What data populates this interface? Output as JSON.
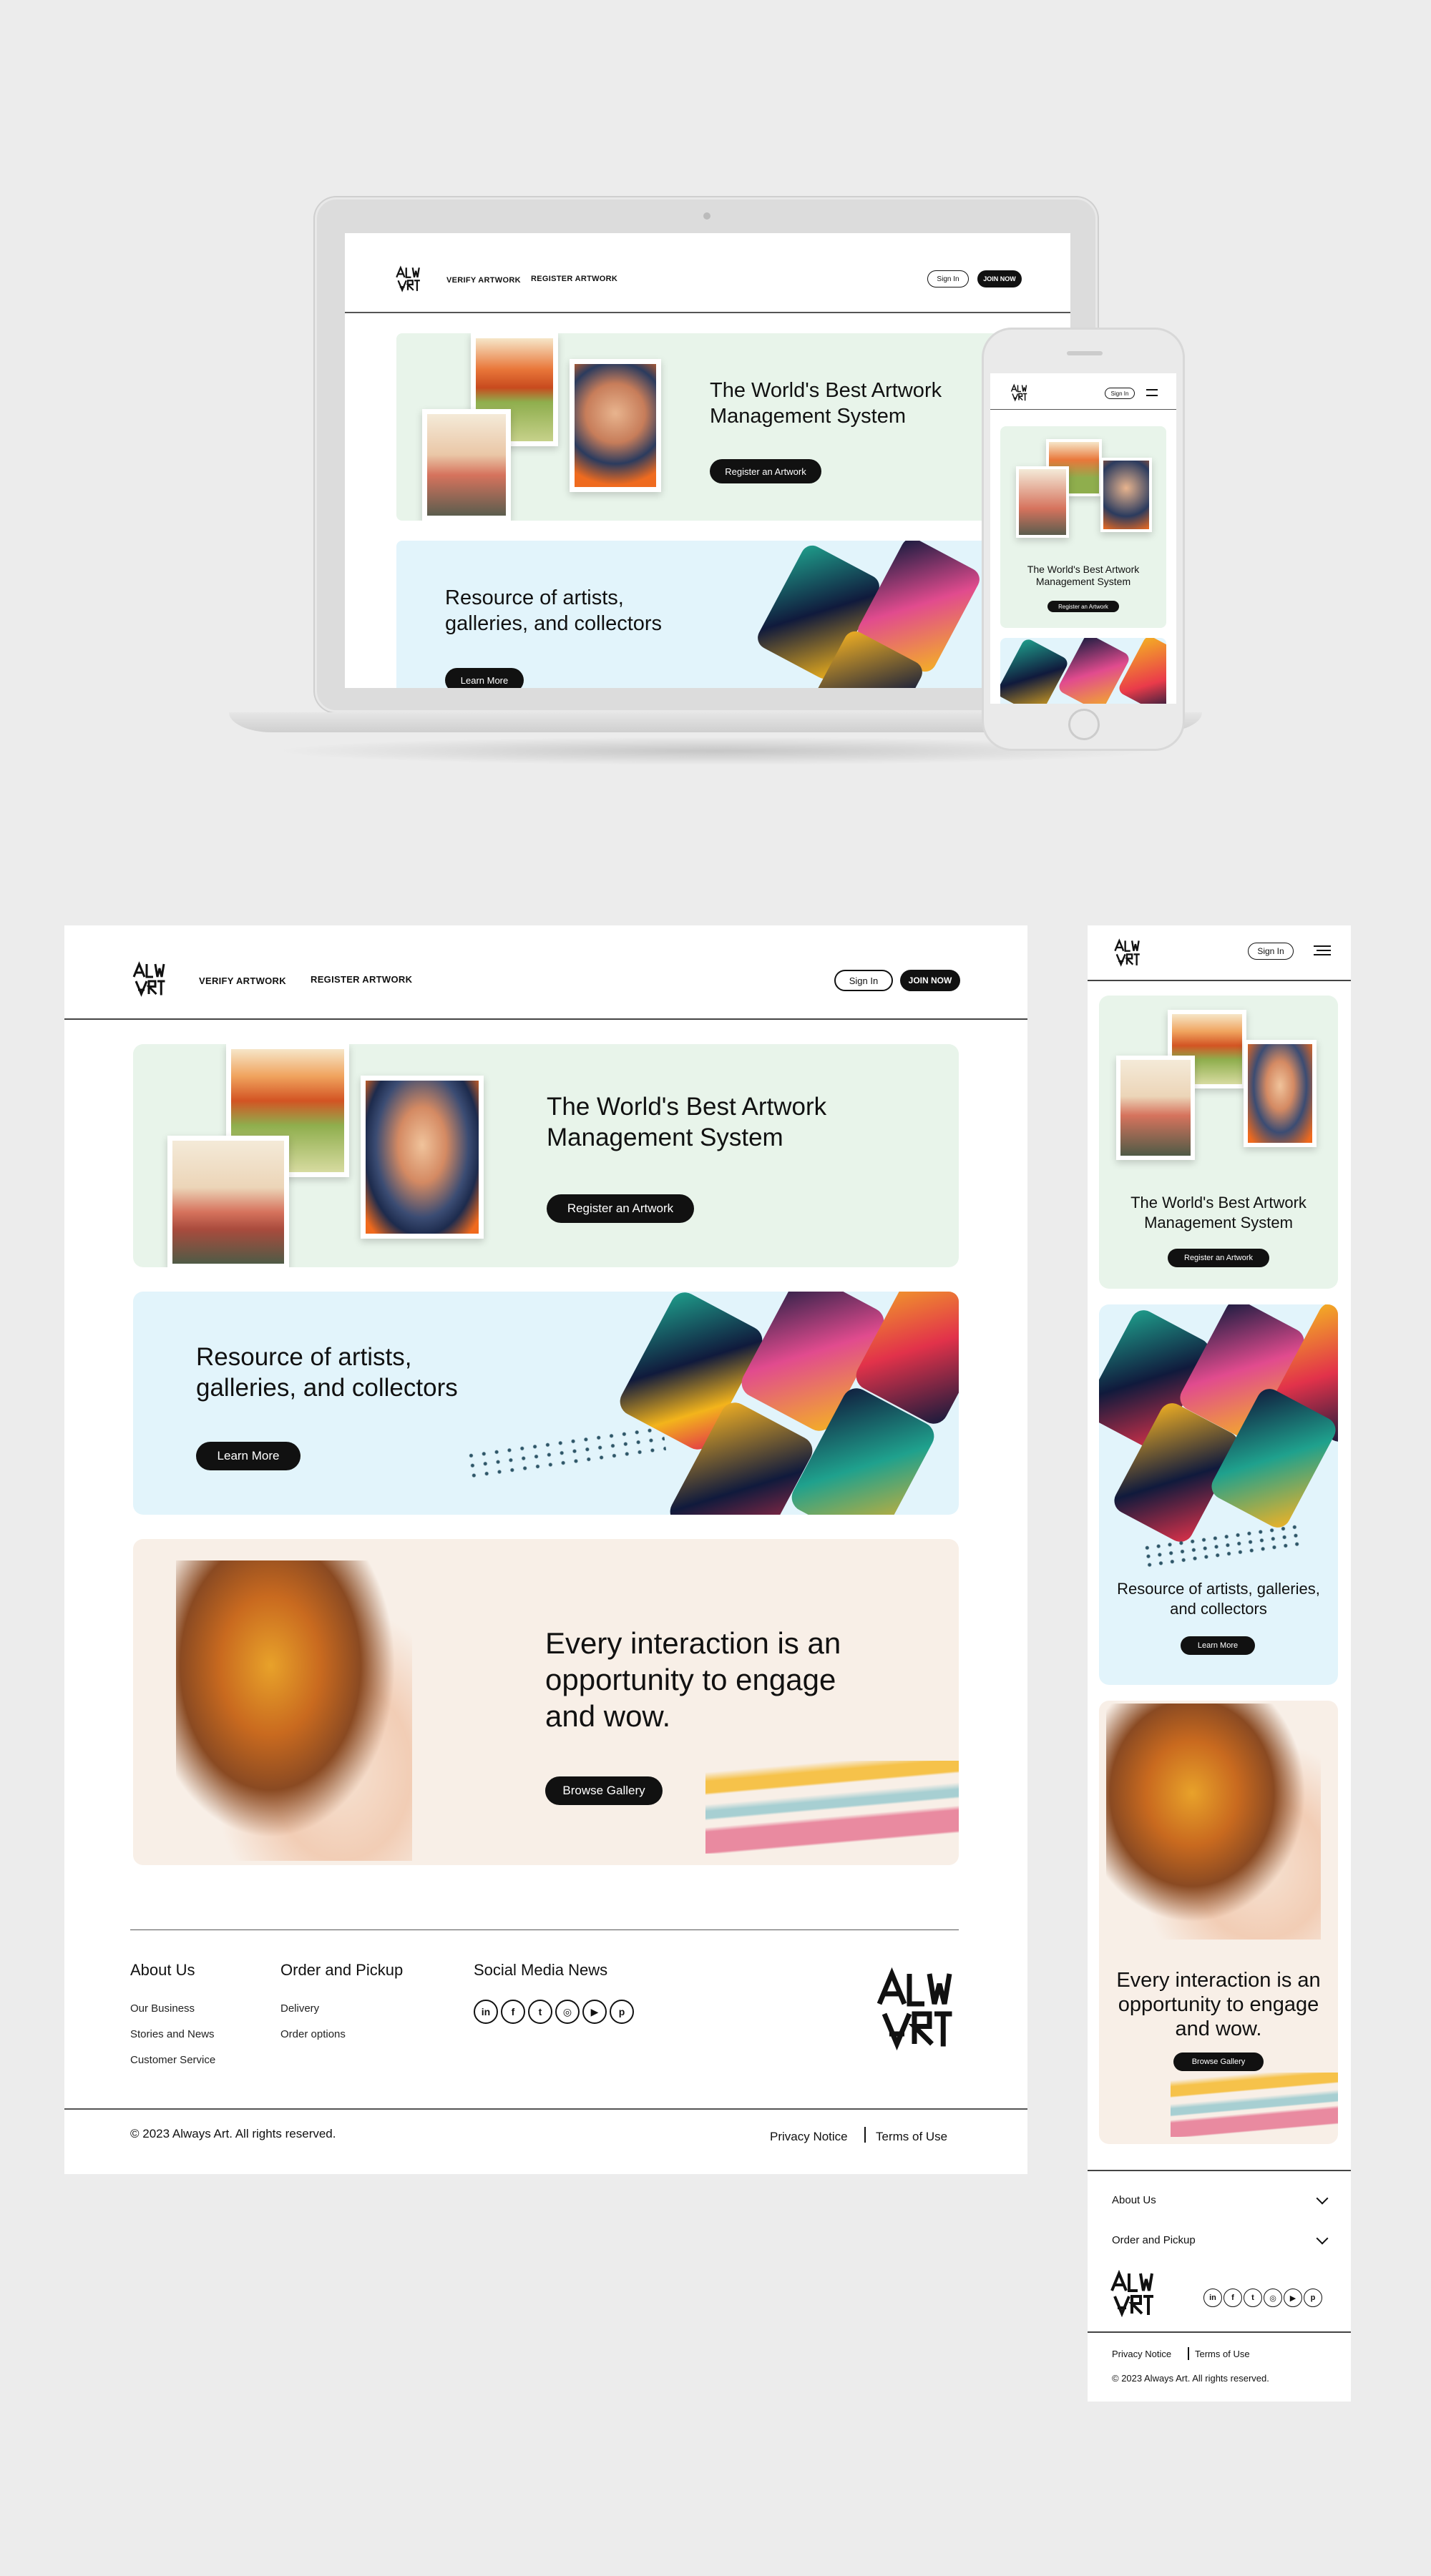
{
  "nav": {
    "verify": "VERIFY ARTWORK",
    "register": "REGISTER ARTWORK",
    "sign_in": "Sign In",
    "join": "JOIN NOW"
  },
  "hero": {
    "title": "The World's Best Artwork Management System",
    "cta": "Register an Artwork"
  },
  "resource": {
    "title": "Resource of artists, galleries, and collectors",
    "cta": "Learn More"
  },
  "engage": {
    "title": "Every interaction is an opportunity to engage and wow.",
    "cta": "Browse Gallery"
  },
  "footer": {
    "about": {
      "heading": "About Us",
      "links": [
        "Our Business",
        "Stories and News",
        "Customer Service"
      ]
    },
    "order": {
      "heading": "Order and Pickup",
      "links": [
        "Delivery",
        "Order options"
      ]
    },
    "social": {
      "heading": "Social Media News",
      "icons": [
        "linkedin-icon",
        "facebook-icon",
        "twitter-icon",
        "instagram-icon",
        "youtube-icon",
        "pinterest-icon"
      ]
    },
    "copyright": "© 2023 Always Art. All rights reserved.",
    "privacy": "Privacy Notice",
    "terms": "Terms of Use"
  },
  "mobile": {
    "about": "About Us",
    "order": "Order and Pickup"
  },
  "brand": {
    "logo_text": "ALWAYS ART"
  },
  "colors": {
    "green_card": "#e8f4ea",
    "blue_card": "#e2f4fb",
    "peach_card": "#f8efe7",
    "dark": "#111111"
  }
}
